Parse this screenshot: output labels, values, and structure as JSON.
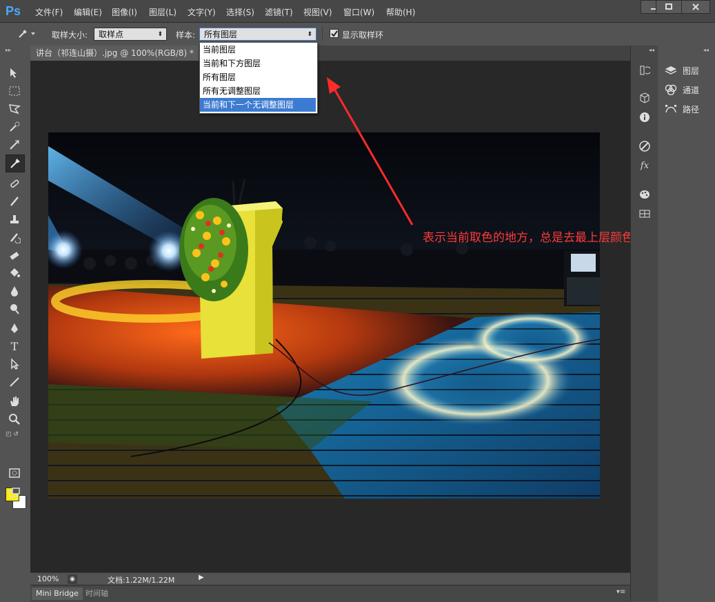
{
  "app": {
    "logo": "Ps"
  },
  "menu": [
    "文件(F)",
    "编辑(E)",
    "图像(I)",
    "图层(L)",
    "文字(Y)",
    "选择(S)",
    "滤镜(T)",
    "视图(V)",
    "窗口(W)",
    "帮助(H)"
  ],
  "options": {
    "sample_size_label": "取样大小:",
    "sample_size_value": "取样点",
    "sample_label": "样本:",
    "sample_value": "所有图层",
    "show_ring_label": "显示取样环",
    "show_ring_checked": true
  },
  "dropdown": {
    "items": [
      "当前图层",
      "当前和下方图层",
      "所有图层",
      "所有无调整图层",
      "当前和下一个无调整图层"
    ],
    "highlighted_index": 4
  },
  "document": {
    "tab_title": "讲台（祁连山摄）.jpg @ 100%(RGB/8) *",
    "zoom": "100%",
    "doc_info": "文档:1.22M/1.22M"
  },
  "bottom_tabs": [
    "Mini Bridge",
    "时间轴"
  ],
  "panels": {
    "items": [
      {
        "label": "图层",
        "icon": "layers-icon"
      },
      {
        "label": "通道",
        "icon": "channels-icon"
      },
      {
        "label": "路径",
        "icon": "paths-icon"
      }
    ]
  },
  "annotation": "表示当前取色的地方，总是去最上层颜色",
  "colors": {
    "foreground": "#ffee00",
    "background": "#ffffff",
    "annotation": "#ff3a3a",
    "selection": "#3c7bd2"
  }
}
